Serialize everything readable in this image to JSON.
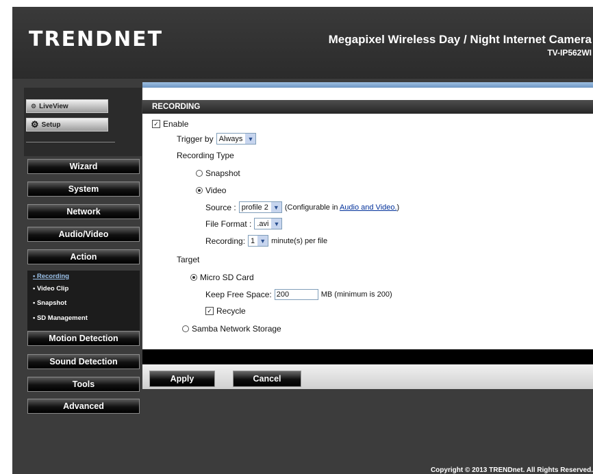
{
  "header": {
    "logo": "TRENDNET",
    "product_title": "Megapixel Wireless Day / Night Internet Camera",
    "model": "TV-IP562WI"
  },
  "sidebar": {
    "liveview_label": "LiveView",
    "setup_label": "Setup",
    "nav": {
      "wizard": "Wizard",
      "system": "System",
      "network": "Network",
      "audio_video": "Audio/Video",
      "action": "Action",
      "motion_detection": "Motion Detection",
      "sound_detection": "Sound Detection",
      "tools": "Tools",
      "advanced": "Advanced"
    },
    "submenu": {
      "recording": "Recording",
      "video_clip": "Video Clip",
      "snapshot": "Snapshot",
      "sd_management": "SD Management"
    }
  },
  "recording": {
    "section_title": "RECORDING",
    "enable_label": "Enable",
    "trigger_label": "Trigger by",
    "trigger_value": "Always",
    "recording_type_label": "Recording Type",
    "snapshot_label": "Snapshot",
    "video_label": "Video",
    "source_label": "Source :",
    "source_value": "profile 2",
    "configurable_prefix": "(Configurable in ",
    "configurable_link": "Audio and Video.",
    "configurable_suffix": ")",
    "file_format_label": "File Format :",
    "file_format_value": ".avi",
    "recording_label": "Recording:",
    "recording_value": "1",
    "recording_unit": "minute(s) per file",
    "target_label": "Target",
    "micro_sd_label": "Micro SD Card",
    "keep_free_label": "Keep Free Space:",
    "keep_free_value": "200",
    "keep_free_unit": "MB (minimum is 200)",
    "recycle_label": "Recycle",
    "samba_label": "Samba Network Storage"
  },
  "actions": {
    "apply": "Apply",
    "cancel": "Cancel"
  },
  "footer": {
    "copyright": "Copyright © 2013 TRENDnet. All Rights Reserved."
  },
  "icons": {
    "liveview": "camera-eye-icon",
    "setup": "gear-icon",
    "dropdown": "chevron-down-icon"
  }
}
